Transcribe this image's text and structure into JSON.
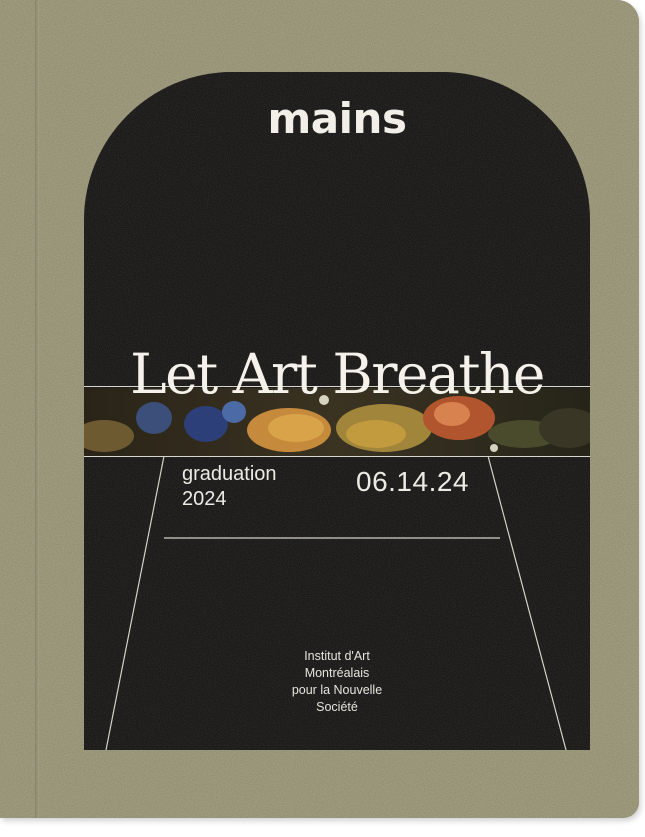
{
  "cover": {
    "brand": "mains",
    "headline": "Let Art Breathe",
    "graduation_word": "graduation",
    "graduation_year": "2024",
    "date": "06.14.24",
    "institute_lines": [
      "Institut d'Art",
      "Montréalais",
      "pour la Nouvelle",
      "Société"
    ]
  },
  "colors": {
    "cover_cloth": "#8a8668",
    "panel": "#0d0c0b",
    "text": "#f1efe8"
  },
  "icons": {
    "painting_strip": "still-life-painting-icon"
  }
}
